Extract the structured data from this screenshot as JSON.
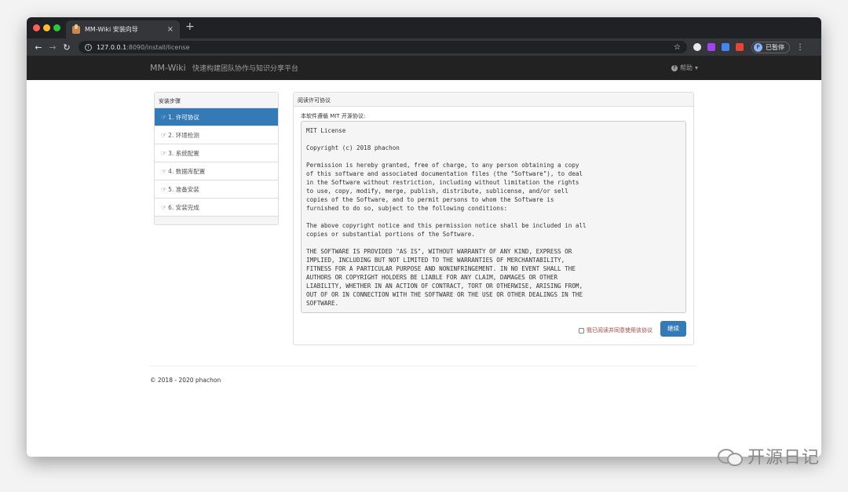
{
  "browser": {
    "tab_title": "MM-Wiki 安装向导",
    "tab_close": "×",
    "new_tab": "+",
    "url_host": "127.0.0.1",
    "url_rest": ":8090/install/license",
    "profile_initial": "P",
    "profile_label": "已暂停"
  },
  "navbar": {
    "brand": "MM-Wiki",
    "subtitle": "快速构建团队协作与知识分享平台",
    "help": "帮助"
  },
  "steps": {
    "heading": "安装步骤",
    "items": [
      {
        "label": "1. 许可协议",
        "active": true
      },
      {
        "label": "2. 环境检测",
        "active": false
      },
      {
        "label": "3. 系统配置",
        "active": false
      },
      {
        "label": "4. 数据库配置",
        "active": false
      },
      {
        "label": "5. 准备安装",
        "active": false
      },
      {
        "label": "6. 安装完成",
        "active": false
      }
    ]
  },
  "license": {
    "heading": "阅读许可协议",
    "intro": "本软件遵循 MIT 开源协议:",
    "text": "MIT License\n\nCopyright (c) 2018 phachon\n\nPermission is hereby granted, free of charge, to any person obtaining a copy\nof this software and associated documentation files (the \"Software\"), to deal\nin the Software without restriction, including without limitation the rights\nto use, copy, modify, merge, publish, distribute, sublicense, and/or sell\ncopies of the Software, and to permit persons to whom the Software is\nfurnished to do so, subject to the following conditions:\n\nThe above copyright notice and this permission notice shall be included in all\ncopies or substantial portions of the Software.\n\nTHE SOFTWARE IS PROVIDED \"AS IS\", WITHOUT WARRANTY OF ANY KIND, EXPRESS OR\nIMPLIED, INCLUDING BUT NOT LIMITED TO THE WARRANTIES OF MERCHANTABILITY,\nFITNESS FOR A PARTICULAR PURPOSE AND NONINFRINGEMENT. IN NO EVENT SHALL THE\nAUTHORS OR COPYRIGHT HOLDERS BE LIABLE FOR ANY CLAIM, DAMAGES OR OTHER\nLIABILITY, WHETHER IN AN ACTION OF CONTRACT, TORT OR OTHERWISE, ARISING FROM,\nOUT OF OR IN CONNECTION WITH THE SOFTWARE OR THE USE OR OTHER DEALINGS IN THE\nSOFTWARE.",
    "agree_label": "我已阅读并同意使用该协议",
    "continue_label": "继续"
  },
  "footer": {
    "copyright": "© 2018 - 2020 phachon"
  },
  "watermark": {
    "text": "开源日记"
  },
  "colors": {
    "primary": "#337ab7",
    "navbar_bg": "#222222",
    "agree_text": "#a94442"
  }
}
